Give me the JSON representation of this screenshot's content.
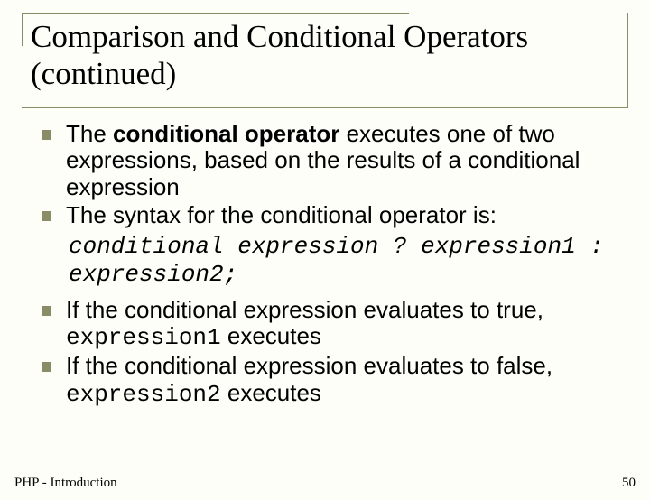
{
  "title": "Comparison and Conditional Operators (continued)",
  "bullets": {
    "b1_pre": "The ",
    "b1_bold": "conditional operator",
    "b1_post": " executes one of two expressions, based on the results of a conditional expression",
    "b2": "The syntax for the conditional operator is:",
    "code_line1": "conditional expression ? expression1 :",
    "code_line2": "expression2;",
    "b3_pre": "If the conditional expression evaluates to true, ",
    "b3_code": "expression1",
    "b3_post": " executes",
    "b4_pre": "If the conditional expression evaluates to false, ",
    "b4_code": "expression2",
    "b4_post": " executes"
  },
  "footer": {
    "left": "PHP - Introduction",
    "right": "50"
  }
}
